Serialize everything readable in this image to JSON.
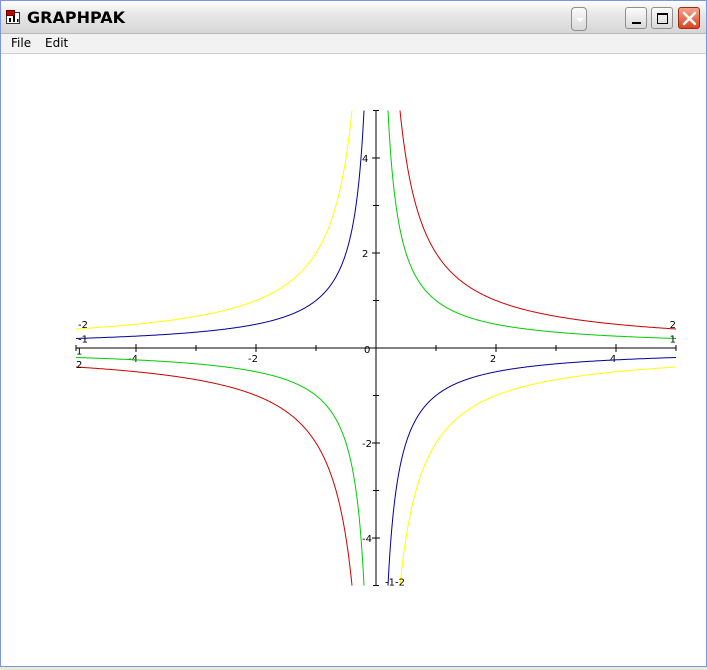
{
  "window": {
    "title": "GRAPHPAK",
    "menu": {
      "file": "File",
      "edit": "Edit"
    }
  },
  "icons": {
    "app": "graphpak-app-icon",
    "rollup": "rollup-icon",
    "minimize": "minimize-icon",
    "maximize": "maximize-icon",
    "close": "close-icon"
  },
  "chart_data": {
    "type": "line",
    "function": "y = k/x",
    "xlim": [
      -5,
      5
    ],
    "ylim": [
      -5,
      5
    ],
    "xticks": [
      -4,
      -2,
      0,
      2,
      4
    ],
    "yticks": [
      -4,
      -2,
      0,
      2,
      4
    ],
    "x_tick_labels": [
      "-4",
      "-2",
      "0",
      "2",
      "4"
    ],
    "y_tick_labels": [
      "4",
      "2",
      "0",
      "-2",
      "-4"
    ],
    "x_minor_step": 1,
    "y_minor_step": 1,
    "grid": false,
    "series": [
      {
        "label": "2",
        "k": 2,
        "color": "#cc0000"
      },
      {
        "label": "1",
        "k": 1,
        "color": "#00cc00"
      },
      {
        "label": "-1",
        "k": -1,
        "color": "#000099"
      },
      {
        "label": "-2",
        "k": -2,
        "color": "#ffff00"
      }
    ]
  }
}
